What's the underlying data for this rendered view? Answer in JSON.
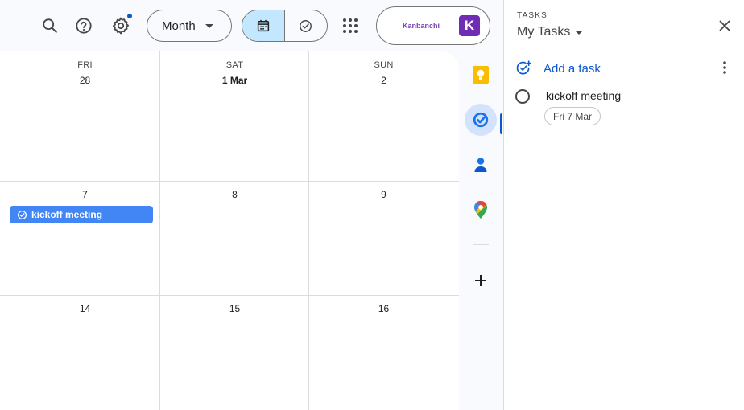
{
  "toolbar": {
    "view_select": "Month",
    "account_app": "Kanbanchi",
    "avatar_letter": "K"
  },
  "calendar": {
    "weekdays": [
      "FRI",
      "SAT",
      "SUN"
    ],
    "weeks": [
      [
        "28",
        "1 Mar",
        "2"
      ],
      [
        "7",
        "8",
        "9"
      ],
      [
        "14",
        "15",
        "16"
      ]
    ],
    "events": [
      {
        "title": "kickoff meeting"
      }
    ]
  },
  "tasks_panel": {
    "label": "TASKS",
    "list_name": "My Tasks",
    "add_task": "Add a task",
    "items": [
      {
        "title": "kickoff meeting",
        "date": "Fri 7 Mar"
      }
    ]
  },
  "colors": {
    "accent": "#0b57d0",
    "event": "#4285f4",
    "selected_segment": "#c2e7ff",
    "avatar": "#6f2db4"
  }
}
